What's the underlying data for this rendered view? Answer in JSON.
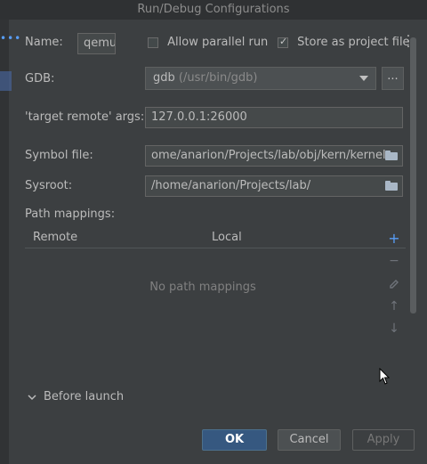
{
  "window": {
    "title": "Run/Debug Configurations"
  },
  "config": {
    "name_label": "Name:",
    "name_value": "qemu",
    "allow_parallel_label": "Allow parallel run",
    "allow_parallel_checked": false,
    "store_as_project_label": "Store as project file",
    "store_as_project_checked": true
  },
  "form": {
    "gdb_label": "GDB:",
    "gdb_value": "gdb",
    "gdb_path": "(/usr/bin/gdb)",
    "gdb_browse": "...",
    "target_remote_label": "'target remote' args:",
    "target_remote_value": "127.0.0.1:26000",
    "symbol_file_label": "Symbol file:",
    "symbol_file_value": "ome/anarion/Projects/lab/obj/kern/kernel",
    "sysroot_label": "Sysroot:",
    "sysroot_value": "/home/anarion/Projects/lab/"
  },
  "path_mappings": {
    "label": "Path mappings:",
    "columns": [
      "Remote",
      "Local"
    ],
    "empty_text": "No path mappings",
    "tools": {
      "add": "+",
      "remove": "−",
      "up": "↑",
      "down": "↓"
    }
  },
  "before_launch": {
    "label": "Before launch"
  },
  "buttons": {
    "ok": "OK",
    "cancel": "Cancel",
    "apply": "Apply"
  },
  "icons": {
    "more": "more-vertical-icon",
    "folder": "folder-icon",
    "edit": "pencil-icon",
    "chevron": "chevron-down-icon"
  },
  "colors": {
    "accent": "#589df6",
    "primary_button": "#365880"
  }
}
